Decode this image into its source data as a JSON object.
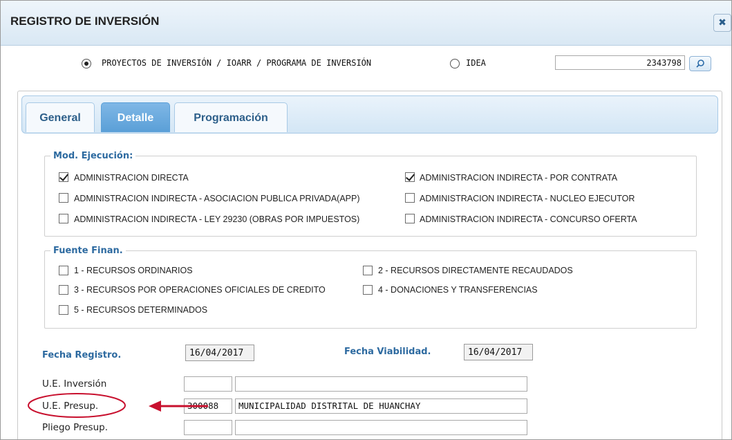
{
  "window": {
    "title": "REGISTRO DE INVERSIÓN",
    "close_icon": "close-icon"
  },
  "type_selector": {
    "option1": {
      "label": "PROYECTOS DE INVERSIÓN / IOARR / PROGRAMA DE INVERSIÓN",
      "selected": true
    },
    "option2": {
      "label": "IDEA",
      "selected": false
    },
    "search_value": "2343798",
    "search_icon": "search-icon"
  },
  "tabs": [
    {
      "label": "General",
      "active": false
    },
    {
      "label": "Detalle",
      "active": true
    },
    {
      "label": "Programación",
      "active": false
    }
  ],
  "mod_ejecucion": {
    "legend": "Mod. Ejecución:",
    "options": [
      {
        "label": "ADMINISTRACION DIRECTA",
        "checked": true
      },
      {
        "label": "ADMINISTRACION INDIRECTA - POR CONTRATA",
        "checked": true
      },
      {
        "label": "ADMINISTRACION INDIRECTA - ASOCIACION PUBLICA PRIVADA(APP)",
        "checked": false
      },
      {
        "label": "ADMINISTRACION INDIRECTA - NUCLEO EJECUTOR",
        "checked": false
      },
      {
        "label": "ADMINISTRACION INDIRECTA - LEY 29230 (OBRAS POR IMPUESTOS)",
        "checked": false
      },
      {
        "label": "ADMINISTRACION INDIRECTA - CONCURSO OFERTA",
        "checked": false
      }
    ]
  },
  "fuente_finan": {
    "legend": "Fuente Finan.",
    "options": [
      {
        "label": "1 - RECURSOS ORDINARIOS",
        "checked": false
      },
      {
        "label": "2 - RECURSOS DIRECTAMENTE RECAUDADOS",
        "checked": false
      },
      {
        "label": "3 - RECURSOS POR OPERACIONES OFICIALES DE CREDITO",
        "checked": false
      },
      {
        "label": "4 - DONACIONES Y TRANSFERENCIAS",
        "checked": false
      },
      {
        "label": "5 - RECURSOS DETERMINADOS",
        "checked": false
      }
    ]
  },
  "fechas": {
    "registro_label": "Fecha Registro.",
    "registro_value": "16/04/2017",
    "viabilidad_label": "Fecha Viabilidad.",
    "viabilidad_value": "16/04/2017"
  },
  "unidades": {
    "ue_inversion": {
      "label": "U.E. Inversión",
      "code": "",
      "name": ""
    },
    "ue_presup": {
      "label": "U.E. Presup.",
      "code": "300088",
      "name": "MUNICIPALIDAD DISTRITAL DE HUANCHAY"
    },
    "pliego_presup": {
      "label": "Pliego Presup.",
      "code": "",
      "name": ""
    }
  },
  "annotation": {
    "color": "#c8102e"
  }
}
